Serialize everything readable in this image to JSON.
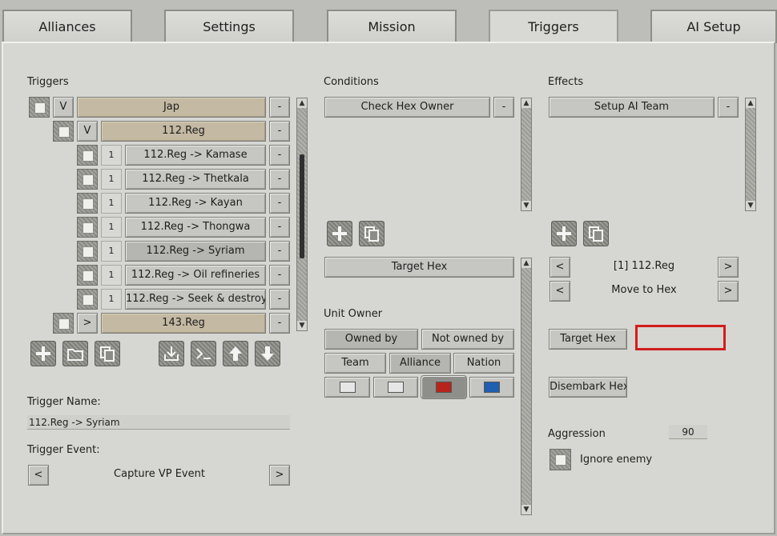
{
  "tabs": [
    "Alliances",
    "Settings",
    "Mission",
    "Triggers",
    "AI Setup"
  ],
  "triggers": {
    "heading": "Triggers",
    "rows": [
      {
        "toggle": "V",
        "label": "Jap"
      },
      {
        "toggle": "V",
        "label": "112.Reg"
      },
      {
        "num": "1",
        "label": "112.Reg -> Kamase"
      },
      {
        "num": "1",
        "label": "112.Reg -> Thetkala"
      },
      {
        "num": "1",
        "label": "112.Reg -> Kayan"
      },
      {
        "num": "1",
        "label": "112.Reg -> Thongwa"
      },
      {
        "num": "1",
        "label": "112.Reg -> Syriam"
      },
      {
        "num": "1",
        "label": "112.Reg -> Oil refineries"
      },
      {
        "num": "1",
        "label": "112.Reg -> Seek & destroy"
      },
      {
        "toggle": ">",
        "label": "143.Reg"
      }
    ],
    "minus": "-",
    "name_label": "Trigger Name:",
    "name_value": "112.Reg -> Syriam",
    "event_label": "Trigger Event:",
    "event_value": "Capture VP Event",
    "prev": "<",
    "next": ">"
  },
  "conditions": {
    "heading": "Conditions",
    "item": "Check Hex Owner",
    "target_hex": "Target Hex",
    "unit_owner_label": "Unit Owner",
    "owned_by": "Owned by",
    "not_owned_by": "Not owned by",
    "team": "Team",
    "alliance": "Alliance",
    "nation": "Nation"
  },
  "effects": {
    "heading": "Effects",
    "item": "Setup AI Team",
    "team_selector": "[1] 112.Reg",
    "action_selector": "Move to Hex",
    "prev": "<",
    "next": ">",
    "target_hex": "Target Hex",
    "disembark_hex": "Disembark Hex",
    "aggression_label": "Aggression",
    "aggression_value": "90",
    "ignore_enemy": "Ignore enemy"
  },
  "colors": {
    "highlight_box": "#d01d1d",
    "swatch_red": "#b8241c",
    "swatch_blue": "#1f5fb0",
    "swatch_white": "#e6e6e6"
  },
  "icons": {
    "triggers_toolbar": [
      "add-icon",
      "folder-icon",
      "copy-icon",
      "import-icon",
      "script-icon",
      "arrow-up-icon",
      "arrow-down-icon"
    ],
    "conditions_toolbar": [
      "add-icon",
      "copy-icon"
    ],
    "effects_toolbar": [
      "add-icon",
      "copy-icon"
    ]
  }
}
